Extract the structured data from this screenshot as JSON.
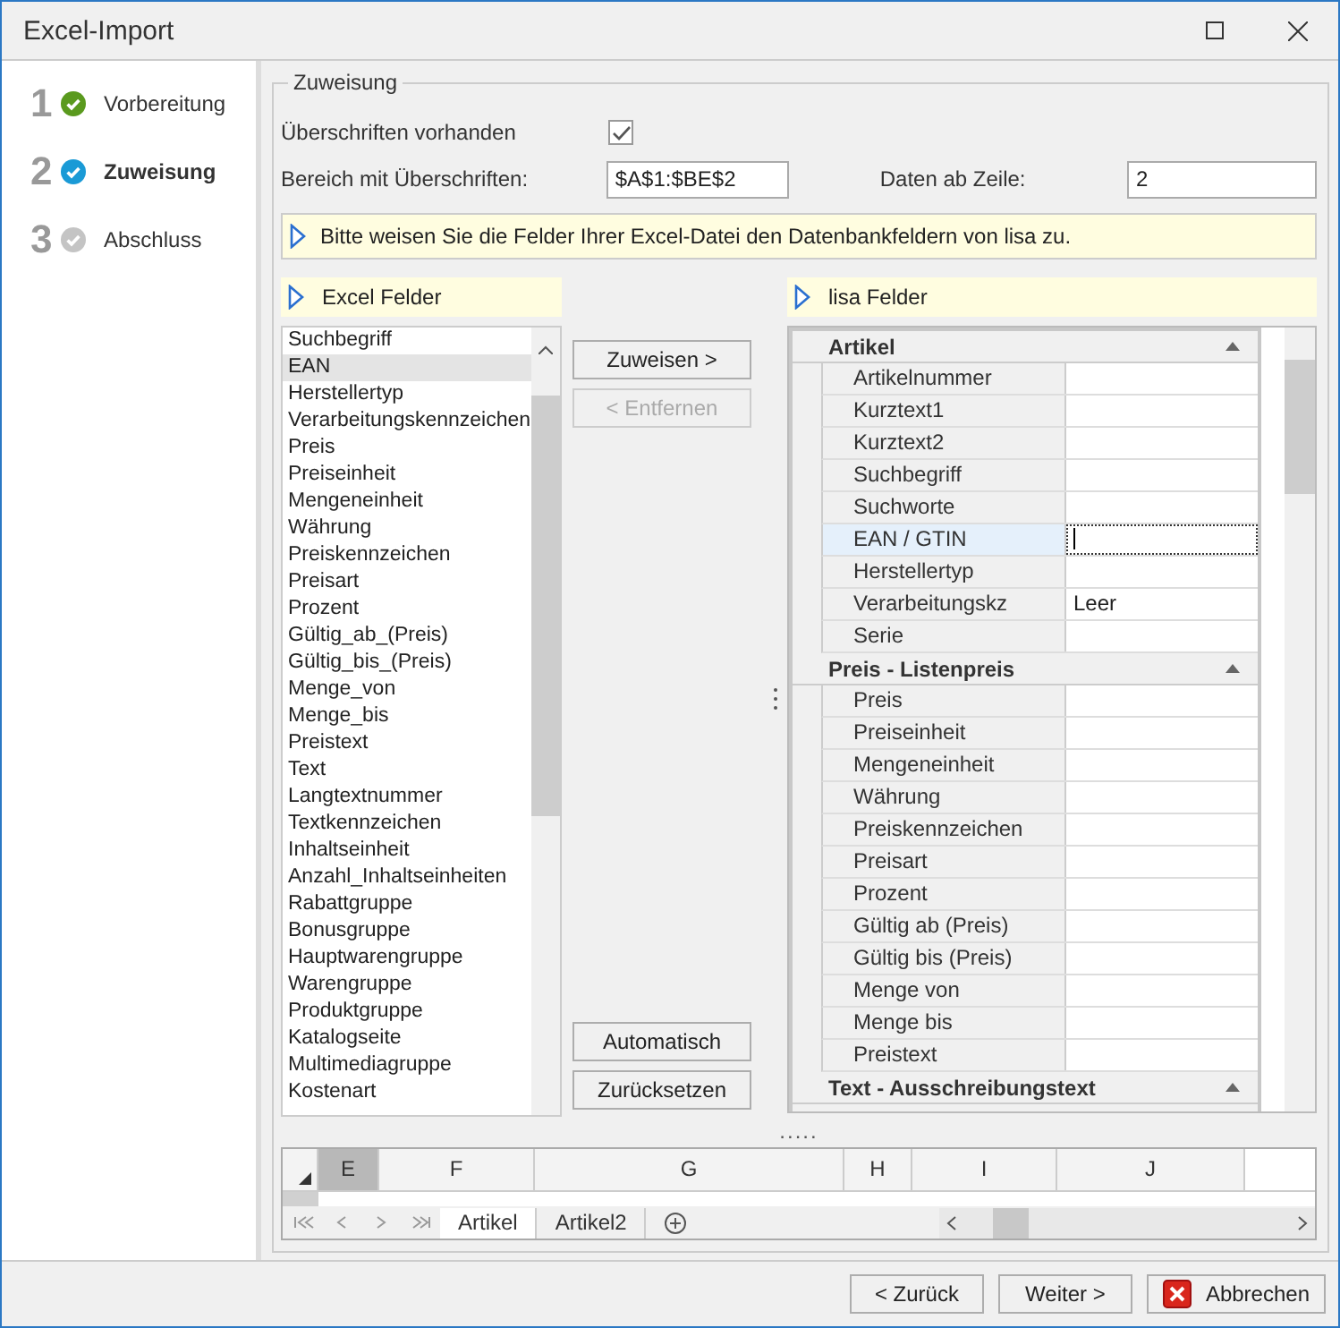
{
  "window": {
    "title": "Excel-Import"
  },
  "steps": [
    {
      "number": "1",
      "label": "Vorbereitung",
      "color": "#5a9a1e",
      "selected": false
    },
    {
      "number": "2",
      "label": "Zuweisung",
      "color": "#1a9ad6",
      "selected": true
    },
    {
      "number": "3",
      "label": "Abschluss",
      "color": "#c4c4c4",
      "selected": false
    }
  ],
  "group_title": "Zuweisung",
  "headers_present": {
    "label": "Überschriften vorhanden",
    "checked": true
  },
  "range": {
    "label": "Bereich mit Überschriften:",
    "value": "$A$1:$BE$2"
  },
  "data_from": {
    "label": "Daten ab Zeile:",
    "value": "2"
  },
  "info": "Bitte weisen Sie die Felder Ihrer Excel-Datei den Datenbankfeldern von lisa zu.",
  "excel_fields": {
    "title": "Excel Felder",
    "items": [
      {
        "label": "Suchbegriff",
        "selected": false
      },
      {
        "label": "EAN",
        "selected": true
      },
      {
        "label": "Herstellertyp",
        "selected": false
      },
      {
        "label": "Verarbeitungskennzeichen",
        "selected": false
      },
      {
        "label": "Preis",
        "selected": false
      },
      {
        "label": "Preiseinheit",
        "selected": false
      },
      {
        "label": "Mengeneinheit",
        "selected": false
      },
      {
        "label": "Währung",
        "selected": false
      },
      {
        "label": "Preiskennzeichen",
        "selected": false
      },
      {
        "label": "Preisart",
        "selected": false
      },
      {
        "label": "Prozent",
        "selected": false
      },
      {
        "label": "Gültig_ab_(Preis)",
        "selected": false
      },
      {
        "label": "Gültig_bis_(Preis)",
        "selected": false
      },
      {
        "label": "Menge_von",
        "selected": false
      },
      {
        "label": "Menge_bis",
        "selected": false
      },
      {
        "label": "Preistext",
        "selected": false
      },
      {
        "label": "Text",
        "selected": false
      },
      {
        "label": "Langtextnummer",
        "selected": false
      },
      {
        "label": "Textkennzeichen",
        "selected": false
      },
      {
        "label": "Inhaltseinheit",
        "selected": false
      },
      {
        "label": "Anzahl_Inhaltseinheiten",
        "selected": false
      },
      {
        "label": "Rabattgruppe",
        "selected": false
      },
      {
        "label": "Bonusgruppe",
        "selected": false
      },
      {
        "label": "Hauptwarengruppe",
        "selected": false
      },
      {
        "label": "Warengruppe",
        "selected": false
      },
      {
        "label": "Produktgruppe",
        "selected": false
      },
      {
        "label": "Katalogseite",
        "selected": false
      },
      {
        "label": "Multimediagruppe",
        "selected": false
      },
      {
        "label": "Kostenart",
        "selected": false
      }
    ]
  },
  "middle_buttons": [
    {
      "label": "Zuweisen >",
      "disabled": false
    },
    {
      "label": "< Entfernen",
      "disabled": true
    }
  ],
  "bottom_buttons": [
    {
      "label": "Automatisch"
    },
    {
      "label": "Zurücksetzen"
    }
  ],
  "lisa_fields": {
    "title": "lisa Felder",
    "categories": [
      {
        "title": "Artikel",
        "expanded": true,
        "rows": [
          {
            "name": "Artikelnummer",
            "value": "",
            "selected": false
          },
          {
            "name": "Kurztext1",
            "value": "",
            "selected": false
          },
          {
            "name": "Kurztext2",
            "value": "",
            "selected": false
          },
          {
            "name": "Suchbegriff",
            "value": "",
            "selected": false
          },
          {
            "name": "Suchworte",
            "value": "",
            "selected": false
          },
          {
            "name": "EAN / GTIN",
            "value": "",
            "selected": true
          },
          {
            "name": "Herstellertyp",
            "value": "",
            "selected": false
          },
          {
            "name": "Verarbeitungskz",
            "value": "Leer",
            "selected": false
          },
          {
            "name": "Serie",
            "value": "",
            "selected": false
          }
        ]
      },
      {
        "title": "Preis - Listenpreis",
        "expanded": true,
        "rows": [
          {
            "name": "Preis",
            "value": "",
            "selected": false
          },
          {
            "name": "Preiseinheit",
            "value": "",
            "selected": false
          },
          {
            "name": "Mengeneinheit",
            "value": "",
            "selected": false
          },
          {
            "name": "Währung",
            "value": "",
            "selected": false
          },
          {
            "name": "Preiskennzeichen",
            "value": "",
            "selected": false
          },
          {
            "name": "Preisart",
            "value": "",
            "selected": false
          },
          {
            "name": "Prozent",
            "value": "",
            "selected": false
          },
          {
            "name": "Gültig ab (Preis)",
            "value": "",
            "selected": false
          },
          {
            "name": "Gültig bis (Preis)",
            "value": "",
            "selected": false
          },
          {
            "name": "Menge von",
            "value": "",
            "selected": false
          },
          {
            "name": "Menge bis",
            "value": "",
            "selected": false
          },
          {
            "name": "Preistext",
            "value": "",
            "selected": false
          }
        ]
      },
      {
        "title": "Text - Ausschreibungstext",
        "expanded": true
      }
    ]
  },
  "splitter": ".....",
  "sheet": {
    "columns": [
      {
        "label": "E",
        "selected": true
      },
      {
        "label": "F",
        "selected": false
      },
      {
        "label": "G",
        "selected": false
      },
      {
        "label": "H",
        "selected": false
      },
      {
        "label": "I",
        "selected": false
      },
      {
        "label": "J",
        "selected": false
      }
    ],
    "tabs": [
      {
        "label": "Artikel",
        "selected": true
      },
      {
        "label": "Artikel2",
        "selected": false
      }
    ]
  },
  "footer_buttons": [
    {
      "label": "< Zurück",
      "kind": "plain"
    },
    {
      "label": "Weiter >",
      "kind": "plain"
    },
    {
      "label": "Abbrechen",
      "kind": "cancel"
    }
  ]
}
